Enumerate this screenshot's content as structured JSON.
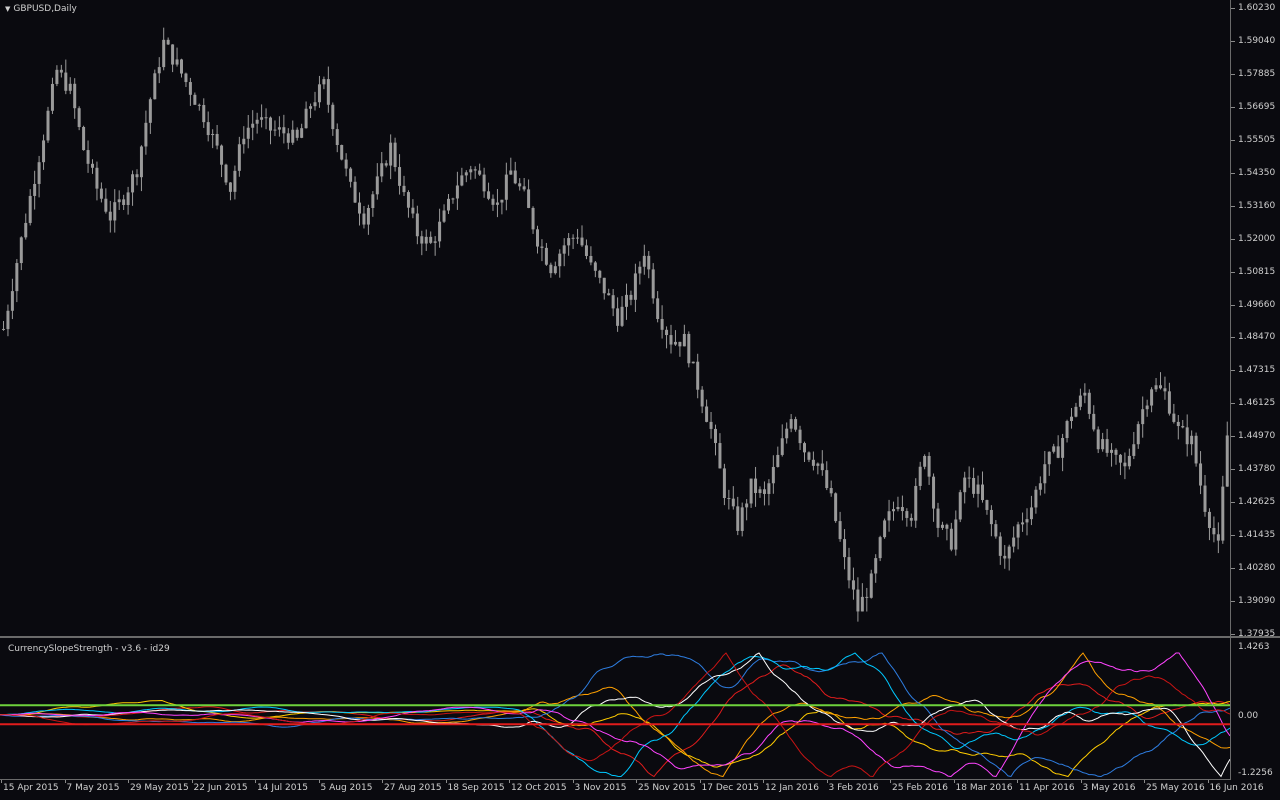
{
  "window": {
    "chart_title": "GBPUSD,Daily",
    "indicator_title": "CurrencySlopeStrength - v3.6 - id29"
  },
  "price_axis": {
    "labels": [
      "1.60230",
      "1.59040",
      "1.57885",
      "1.56695",
      "1.55505",
      "1.54350",
      "1.53160",
      "1.52000",
      "1.50815",
      "1.49660",
      "1.48470",
      "1.47315",
      "1.46125",
      "1.44970",
      "1.43780",
      "1.42625",
      "1.41435",
      "1.40280",
      "1.39090",
      "1.37935"
    ]
  },
  "indicator_axis": {
    "top": "1.4263",
    "mid": "0.00",
    "bottom": "-1.2256"
  },
  "date_axis": {
    "labels": [
      "15 Apr 2015",
      "7 May 2015",
      "29 May 2015",
      "22 Jun 2015",
      "14 Jul 2015",
      "5 Aug 2015",
      "27 Aug 2015",
      "18 Sep 2015",
      "12 Oct 2015",
      "3 Nov 2015",
      "25 Nov 2015",
      "17 Dec 2015",
      "12 Jan 2016",
      "3 Feb 2016",
      "25 Feb 2016",
      "18 Mar 2016",
      "11 Apr 2016",
      "3 May 2016",
      "25 May 2016",
      "16 Jun 2016"
    ]
  },
  "colors": {
    "background": "#0a0a0f",
    "candle": "#9a9a9a",
    "upper_level": "#6ed23c",
    "lower_level": "#e01c1c",
    "text": "#d0d0d0",
    "series": [
      "#e01c1c",
      "#ffcc00",
      "#ffa000",
      "#2e7de0",
      "#00c8ff",
      "#ffffff",
      "#ff44ff",
      "#c81414"
    ]
  },
  "chart_data": {
    "type": "candlestick",
    "symbol": "GBPUSD",
    "timeframe": "Daily",
    "ylim": [
      1.37935,
      1.6023
    ],
    "close_path": [
      [
        0,
        1.488
      ],
      [
        3,
        1.512
      ],
      [
        6,
        1.535
      ],
      [
        9,
        1.557
      ],
      [
        12,
        1.58
      ],
      [
        15,
        1.573
      ],
      [
        18,
        1.552
      ],
      [
        21,
        1.538
      ],
      [
        24,
        1.528
      ],
      [
        27,
        1.535
      ],
      [
        30,
        1.545
      ],
      [
        33,
        1.57
      ],
      [
        36,
        1.59
      ],
      [
        39,
        1.582
      ],
      [
        42,
        1.573
      ],
      [
        45,
        1.564
      ],
      [
        48,
        1.552
      ],
      [
        51,
        1.538
      ],
      [
        54,
        1.558
      ],
      [
        57,
        1.563
      ],
      [
        60,
        1.559
      ],
      [
        63,
        1.558
      ],
      [
        66,
        1.555
      ],
      [
        69,
        1.568
      ],
      [
        72,
        1.575
      ],
      [
        75,
        1.555
      ],
      [
        78,
        1.538
      ],
      [
        81,
        1.528
      ],
      [
        84,
        1.54
      ],
      [
        87,
        1.553
      ],
      [
        90,
        1.535
      ],
      [
        93,
        1.522
      ],
      [
        96,
        1.518
      ],
      [
        99,
        1.528
      ],
      [
        102,
        1.54
      ],
      [
        105,
        1.546
      ],
      [
        108,
        1.54
      ],
      [
        111,
        1.532
      ],
      [
        114,
        1.544
      ],
      [
        117,
        1.535
      ],
      [
        120,
        1.52
      ],
      [
        123,
        1.51
      ],
      [
        126,
        1.518
      ],
      [
        129,
        1.522
      ],
      [
        132,
        1.51
      ],
      [
        135,
        1.502
      ],
      [
        138,
        1.492
      ],
      [
        141,
        1.5
      ],
      [
        144,
        1.516
      ],
      [
        147,
        1.494
      ],
      [
        150,
        1.484
      ],
      [
        153,
        1.484
      ],
      [
        156,
        1.468
      ],
      [
        159,
        1.452
      ],
      [
        162,
        1.43
      ],
      [
        165,
        1.418
      ],
      [
        168,
        1.432
      ],
      [
        171,
        1.428
      ],
      [
        174,
        1.442
      ],
      [
        177,
        1.458
      ],
      [
        180,
        1.445
      ],
      [
        183,
        1.44
      ],
      [
        186,
        1.427
      ],
      [
        189,
        1.405
      ],
      [
        192,
        1.388
      ],
      [
        195,
        1.398
      ],
      [
        198,
        1.418
      ],
      [
        201,
        1.427
      ],
      [
        204,
        1.422
      ],
      [
        207,
        1.445
      ],
      [
        210,
        1.418
      ],
      [
        213,
        1.412
      ],
      [
        216,
        1.435
      ],
      [
        219,
        1.43
      ],
      [
        222,
        1.418
      ],
      [
        225,
        1.405
      ],
      [
        228,
        1.418
      ],
      [
        231,
        1.425
      ],
      [
        234,
        1.44
      ],
      [
        237,
        1.445
      ],
      [
        240,
        1.458
      ],
      [
        243,
        1.465
      ],
      [
        246,
        1.448
      ],
      [
        249,
        1.442
      ],
      [
        252,
        1.438
      ],
      [
        255,
        1.455
      ],
      [
        258,
        1.468
      ],
      [
        261,
        1.465
      ],
      [
        264,
        1.452
      ],
      [
        267,
        1.448
      ],
      [
        270,
        1.425
      ],
      [
        273,
        1.41
      ],
      [
        276,
        1.47
      ]
    ],
    "indicator": {
      "levels": [
        0.2,
        -0.2
      ],
      "range": [
        -1.2256,
        1.4263
      ]
    }
  }
}
